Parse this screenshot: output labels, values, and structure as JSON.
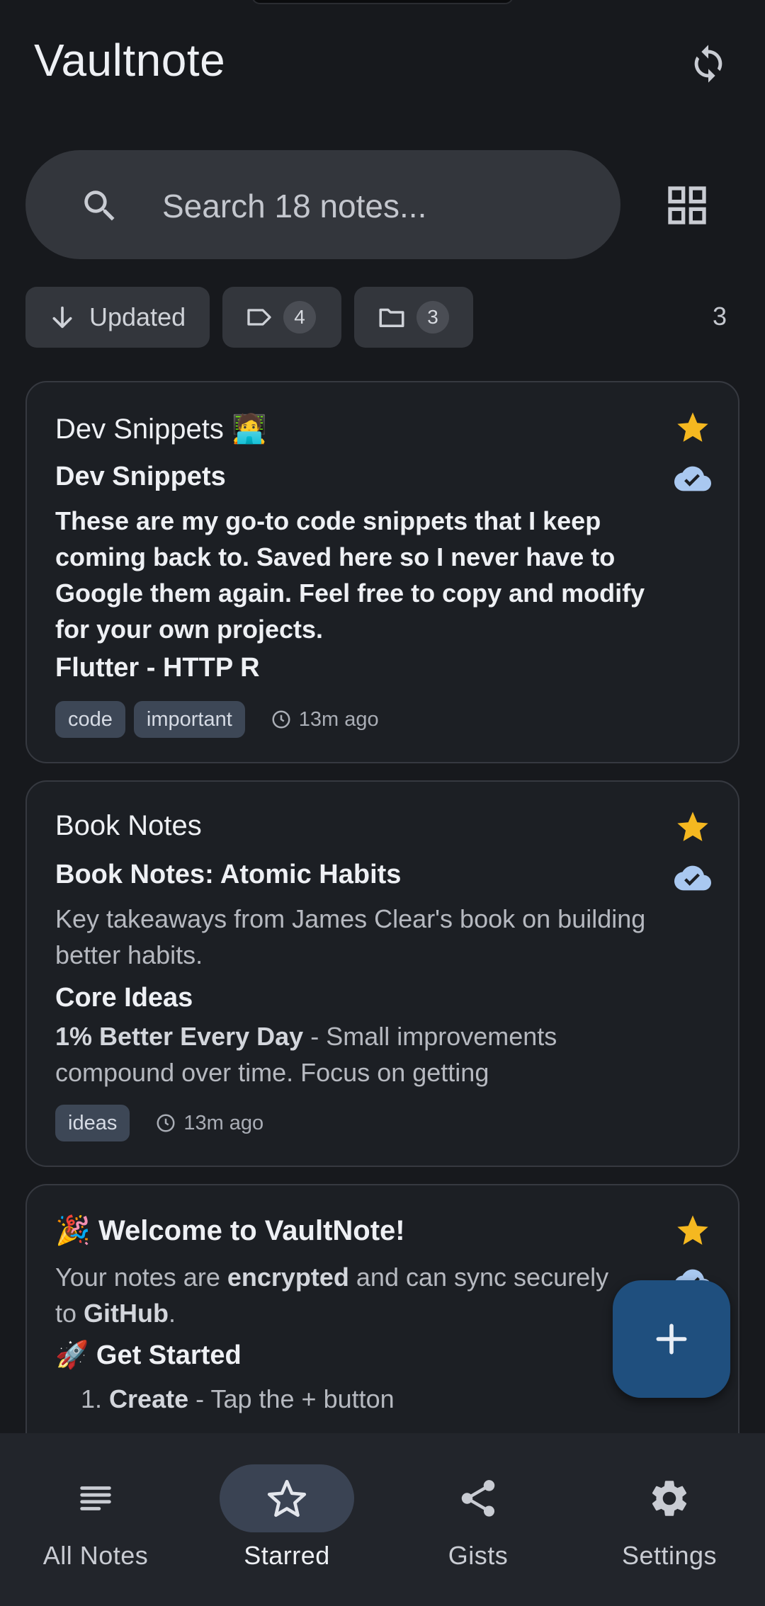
{
  "app": {
    "title": "Vaultnote"
  },
  "search": {
    "placeholder": "Search 18 notes..."
  },
  "filters": {
    "sort_label": "Updated",
    "tags_count": "4",
    "folders_count": "3",
    "result_count": "3"
  },
  "notes": [
    {
      "title": "Dev Snippets 🧑‍💻",
      "heading": "Dev Snippets",
      "body": "These are my go-to code snippets that I keep coming back to. Saved here so I never have to Google them again. Feel free to copy and modify for your own projects.",
      "subheading": "Flutter - HTTP R",
      "tags": [
        "code",
        "important"
      ],
      "time": "13m ago",
      "starred": true,
      "synced": true
    },
    {
      "title": "Book Notes",
      "heading": "Book Notes: Atomic Habits",
      "body": "Key takeaways from James Clear's book on building better habits.",
      "subheading": "Core Ideas",
      "bullet_bold": "1% Better Every Day",
      "bullet_rest": " - Small improvements compound over time. Focus on getting",
      "tags": [
        "ideas"
      ],
      "time": "13m ago",
      "starred": true,
      "synced": true
    },
    {
      "title_emoji": "🎉",
      "title": "Welcome to VaultNote!",
      "body_1": "Your notes are ",
      "body_bold_1": "encrypted",
      "body_2": " and can sync securely to ",
      "body_bold_2": "GitHub",
      "body_3": ".",
      "subheading_emoji": "🚀",
      "subheading": "Get Started",
      "list_num": "1.",
      "list_bold": "Create",
      "list_rest": " - Tap the + button",
      "starred": true
    }
  ],
  "nav": {
    "items": [
      {
        "label": "All Notes",
        "icon": "notes-list-icon",
        "active": false
      },
      {
        "label": "Starred",
        "icon": "star-outline-icon",
        "active": true
      },
      {
        "label": "Gists",
        "icon": "share-icon",
        "active": false
      },
      {
        "label": "Settings",
        "icon": "gear-icon",
        "active": false
      }
    ]
  },
  "colors": {
    "background": "#17191d",
    "card": "#1c1f24",
    "star": "#f5b820",
    "cloud": "#a9c8f0",
    "fab": "#1f4f7e",
    "tag": "#3d4756"
  }
}
